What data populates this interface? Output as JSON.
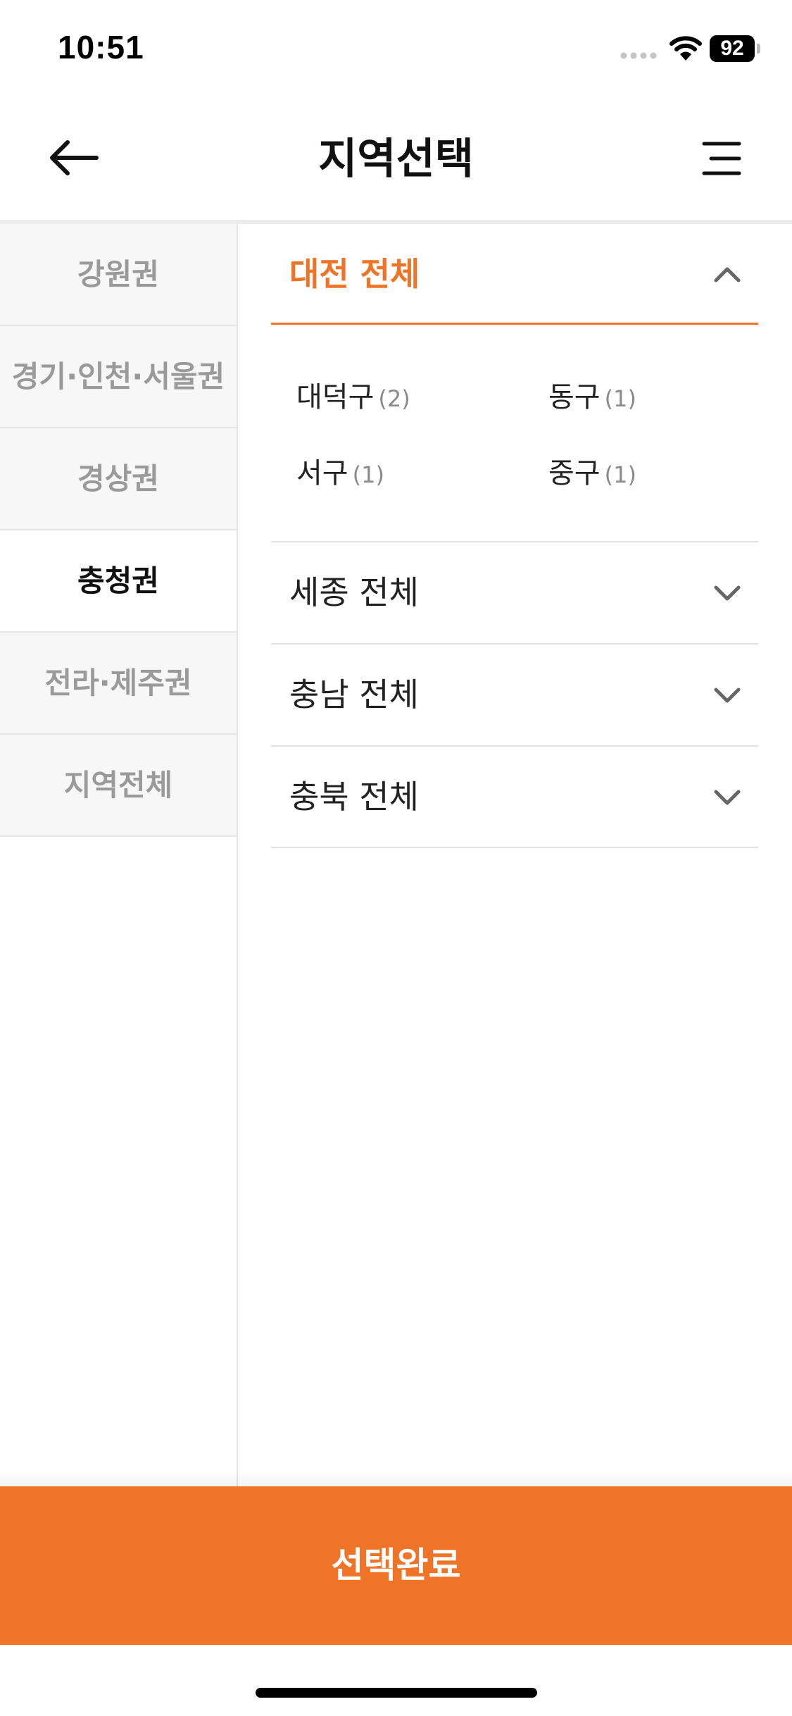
{
  "status_bar": {
    "time": "10:51",
    "battery": "92"
  },
  "header": {
    "title": "지역선택",
    "back_icon": "arrow-left-icon",
    "menu_icon": "menu-lines-icon"
  },
  "region_tabs": {
    "items": [
      {
        "label": "강원권",
        "active": false
      },
      {
        "label": "경기·인천·서울권",
        "active": false
      },
      {
        "label": "경상권",
        "active": false
      },
      {
        "label": "충청권",
        "active": true
      },
      {
        "label": "전라·제주권",
        "active": false
      },
      {
        "label": "지역전체",
        "active": false
      }
    ]
  },
  "accordion": {
    "sections": [
      {
        "title": "대전 전체",
        "expanded": true,
        "districts": [
          {
            "name": "대덕구",
            "count": "(2)"
          },
          {
            "name": "동구",
            "count": "(1)"
          },
          {
            "name": "서구",
            "count": "(1)"
          },
          {
            "name": "중구",
            "count": "(1)"
          }
        ]
      },
      {
        "title": "세종 전체",
        "expanded": false
      },
      {
        "title": "충남 전체",
        "expanded": false
      },
      {
        "title": "충북 전체",
        "expanded": false
      }
    ]
  },
  "footer": {
    "confirm_label": "선택완료"
  },
  "colors": {
    "accent": "#f07428",
    "inactive_tab_text": "#9a9a9a",
    "inactive_tab_bg": "#f7f7f7"
  }
}
